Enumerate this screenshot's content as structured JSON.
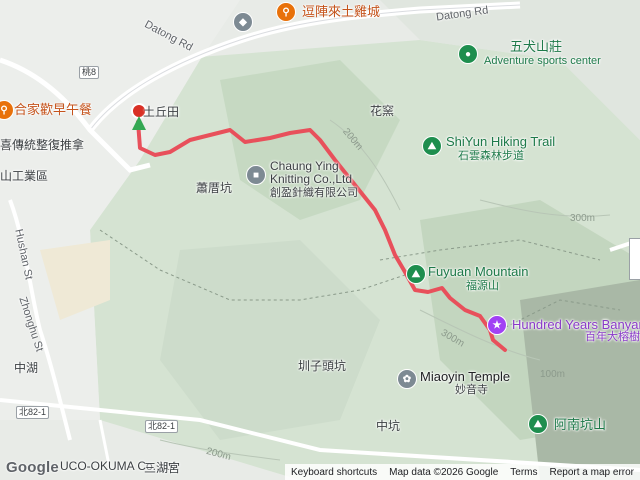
{
  "map": {
    "labels": {
      "datong_rd_left": "Datong Rd",
      "datong_rd_right": "Datong Rd",
      "restaurant_top": "逗陣來土雞城",
      "wuquan_name": "五犬山莊",
      "wuquan_sub": "Adventure sports center",
      "dugutian": "土丘田",
      "huayao": "花窯",
      "shiyun_en": "ShiYun Hiking Trail",
      "shiyun_zh": "石雲森林步道",
      "breakfast": "合家歡早午餐",
      "massage": "喜傳統整復推拿",
      "industrial": "山工業區",
      "chuangying_en": "Chaung Ying Knitting Co.,Ltd",
      "chuangying_zh": "創盈針織有限公司",
      "xiaodun": "蕭厝坑",
      "fuyuan_en": "Fuyuan Mountain",
      "fuyuan_zh": "福源山",
      "banyan_en": "Hundred Years Banyan",
      "banyan_zh": "百年大榕樹",
      "hushan": "Hushan St",
      "zhongzhu": "Zhonghu St",
      "zhonghu": "中湖",
      "zhouzitou": "圳子頭坑",
      "miaoyin_en": "Miaoyin Temple",
      "miaoyin_zh": "妙音寺",
      "zhongkeng": "中坑",
      "ankeng": "阿南坑山",
      "bottom_left": "UCO-OKUMA Co.,Ltd.",
      "bottom_store": "三湖宮",
      "contour_200": "200m",
      "contour_300a": "300m",
      "contour_300b": "300m",
      "contour_200b": "200m",
      "contour_100": "100m"
    },
    "shields": {
      "tao8": "桃8",
      "bei82_1a": "北82-1",
      "bei82_1b": "北82-1"
    },
    "route_color": "#e8505b",
    "footer": {
      "shortcuts": "Keyboard shortcuts",
      "mapdata": "Map data ©2026 Google",
      "terms": "Terms",
      "report": "Report a map error"
    },
    "logo": "Google"
  }
}
